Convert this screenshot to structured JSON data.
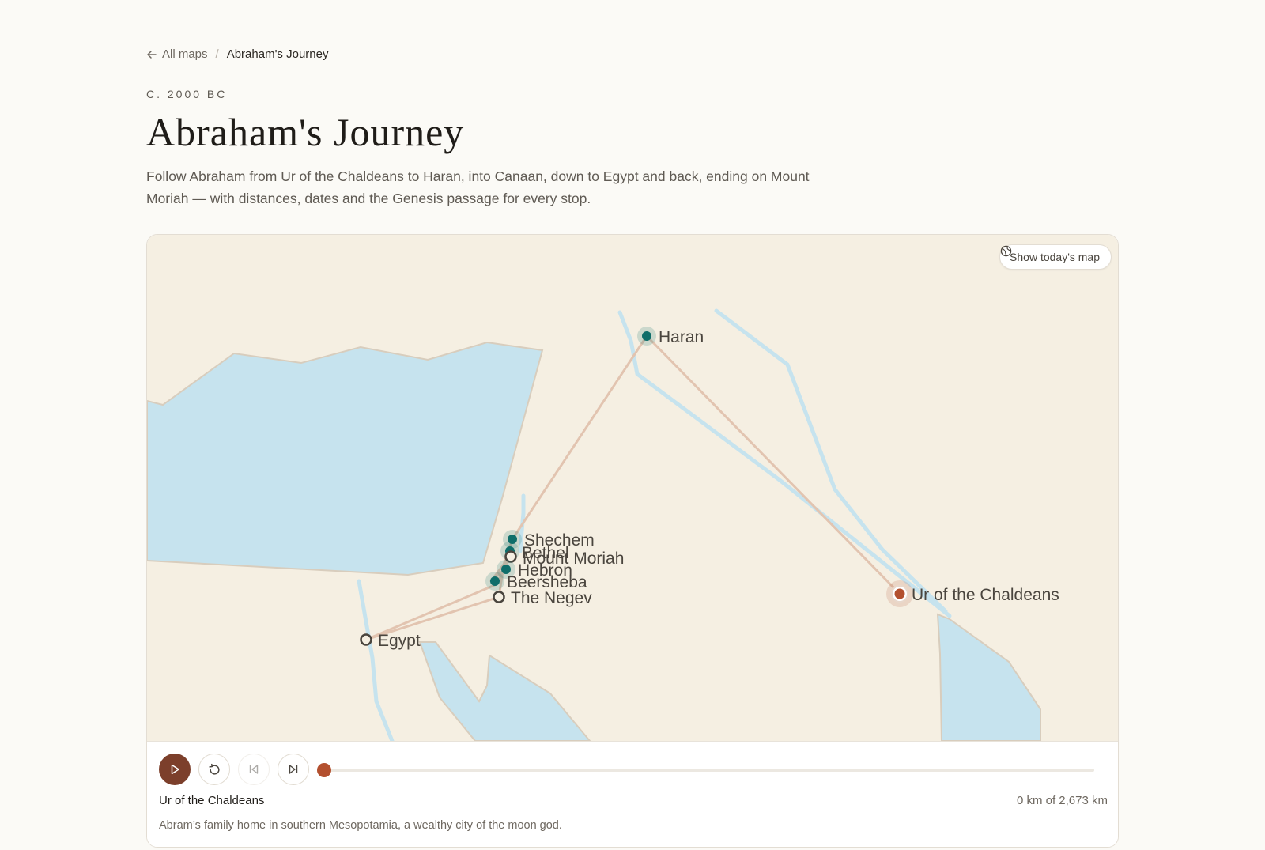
{
  "breadcrumb": {
    "back_label": "All maps",
    "separator": "/",
    "current": "Abraham's Journey"
  },
  "header": {
    "eyebrow": "C. 2000 BC",
    "title": "Abraham's Journey",
    "description": "Follow Abraham from Ur of the Chaldeans to Haran, into Canaan, down to Egypt and back, ending on Mount Moriah — with distances, dates and the Genesis passage for every stop."
  },
  "map": {
    "today_button_label": "Show today's map",
    "places": {
      "haran": "Haran",
      "ur": "Ur of the Chaldeans",
      "shechem": "Shechem",
      "bethel": "Bethel",
      "moriah": "Mount Moriah",
      "hebron": "Hebron",
      "beersheba": "Beersheba",
      "negev": "The Negev",
      "egypt": "Egypt"
    },
    "colors": {
      "land": "#f5efe2",
      "water": "#c6e3ee",
      "route": "#e2c4b0",
      "visited_marker": "#0f6e6a",
      "current_marker": "#b3502f"
    }
  },
  "player": {
    "play_icon": "play-icon",
    "restart_icon": "restart-icon",
    "prev_icon": "skip-back-icon",
    "next_icon": "skip-forward-icon",
    "progress_fraction": 0,
    "current_stop": "Ur of the Chaldeans",
    "distance": "0 km of 2,673 km",
    "stop_description": "Abram’s family home in southern Mesopotamia, a wealthy city of the moon god."
  }
}
